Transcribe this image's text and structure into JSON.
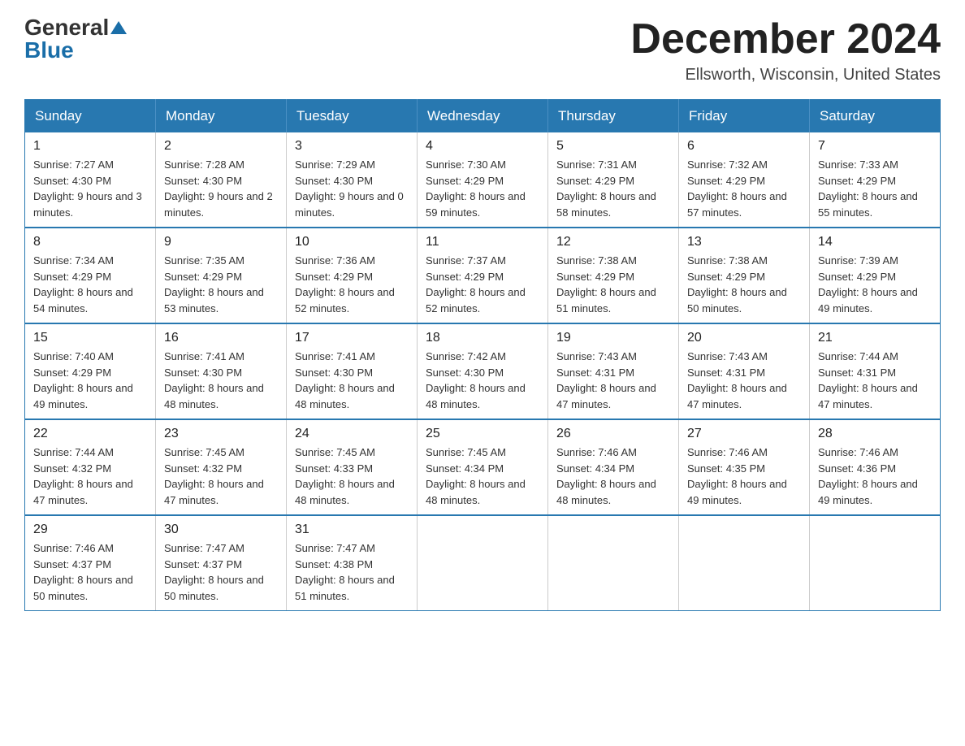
{
  "logo": {
    "general": "General",
    "blue": "Blue"
  },
  "title": {
    "month": "December 2024",
    "location": "Ellsworth, Wisconsin, United States"
  },
  "weekdays": [
    "Sunday",
    "Monday",
    "Tuesday",
    "Wednesday",
    "Thursday",
    "Friday",
    "Saturday"
  ],
  "weeks": [
    [
      {
        "day": "1",
        "sunrise": "7:27 AM",
        "sunset": "4:30 PM",
        "daylight": "9 hours and 3 minutes."
      },
      {
        "day": "2",
        "sunrise": "7:28 AM",
        "sunset": "4:30 PM",
        "daylight": "9 hours and 2 minutes."
      },
      {
        "day": "3",
        "sunrise": "7:29 AM",
        "sunset": "4:30 PM",
        "daylight": "9 hours and 0 minutes."
      },
      {
        "day": "4",
        "sunrise": "7:30 AM",
        "sunset": "4:29 PM",
        "daylight": "8 hours and 59 minutes."
      },
      {
        "day": "5",
        "sunrise": "7:31 AM",
        "sunset": "4:29 PM",
        "daylight": "8 hours and 58 minutes."
      },
      {
        "day": "6",
        "sunrise": "7:32 AM",
        "sunset": "4:29 PM",
        "daylight": "8 hours and 57 minutes."
      },
      {
        "day": "7",
        "sunrise": "7:33 AM",
        "sunset": "4:29 PM",
        "daylight": "8 hours and 55 minutes."
      }
    ],
    [
      {
        "day": "8",
        "sunrise": "7:34 AM",
        "sunset": "4:29 PM",
        "daylight": "8 hours and 54 minutes."
      },
      {
        "day": "9",
        "sunrise": "7:35 AM",
        "sunset": "4:29 PM",
        "daylight": "8 hours and 53 minutes."
      },
      {
        "day": "10",
        "sunrise": "7:36 AM",
        "sunset": "4:29 PM",
        "daylight": "8 hours and 52 minutes."
      },
      {
        "day": "11",
        "sunrise": "7:37 AM",
        "sunset": "4:29 PM",
        "daylight": "8 hours and 52 minutes."
      },
      {
        "day": "12",
        "sunrise": "7:38 AM",
        "sunset": "4:29 PM",
        "daylight": "8 hours and 51 minutes."
      },
      {
        "day": "13",
        "sunrise": "7:38 AM",
        "sunset": "4:29 PM",
        "daylight": "8 hours and 50 minutes."
      },
      {
        "day": "14",
        "sunrise": "7:39 AM",
        "sunset": "4:29 PM",
        "daylight": "8 hours and 49 minutes."
      }
    ],
    [
      {
        "day": "15",
        "sunrise": "7:40 AM",
        "sunset": "4:29 PM",
        "daylight": "8 hours and 49 minutes."
      },
      {
        "day": "16",
        "sunrise": "7:41 AM",
        "sunset": "4:30 PM",
        "daylight": "8 hours and 48 minutes."
      },
      {
        "day": "17",
        "sunrise": "7:41 AM",
        "sunset": "4:30 PM",
        "daylight": "8 hours and 48 minutes."
      },
      {
        "day": "18",
        "sunrise": "7:42 AM",
        "sunset": "4:30 PM",
        "daylight": "8 hours and 48 minutes."
      },
      {
        "day": "19",
        "sunrise": "7:43 AM",
        "sunset": "4:31 PM",
        "daylight": "8 hours and 47 minutes."
      },
      {
        "day": "20",
        "sunrise": "7:43 AM",
        "sunset": "4:31 PM",
        "daylight": "8 hours and 47 minutes."
      },
      {
        "day": "21",
        "sunrise": "7:44 AM",
        "sunset": "4:31 PM",
        "daylight": "8 hours and 47 minutes."
      }
    ],
    [
      {
        "day": "22",
        "sunrise": "7:44 AM",
        "sunset": "4:32 PM",
        "daylight": "8 hours and 47 minutes."
      },
      {
        "day": "23",
        "sunrise": "7:45 AM",
        "sunset": "4:32 PM",
        "daylight": "8 hours and 47 minutes."
      },
      {
        "day": "24",
        "sunrise": "7:45 AM",
        "sunset": "4:33 PM",
        "daylight": "8 hours and 48 minutes."
      },
      {
        "day": "25",
        "sunrise": "7:45 AM",
        "sunset": "4:34 PM",
        "daylight": "8 hours and 48 minutes."
      },
      {
        "day": "26",
        "sunrise": "7:46 AM",
        "sunset": "4:34 PM",
        "daylight": "8 hours and 48 minutes."
      },
      {
        "day": "27",
        "sunrise": "7:46 AM",
        "sunset": "4:35 PM",
        "daylight": "8 hours and 49 minutes."
      },
      {
        "day": "28",
        "sunrise": "7:46 AM",
        "sunset": "4:36 PM",
        "daylight": "8 hours and 49 minutes."
      }
    ],
    [
      {
        "day": "29",
        "sunrise": "7:46 AM",
        "sunset": "4:37 PM",
        "daylight": "8 hours and 50 minutes."
      },
      {
        "day": "30",
        "sunrise": "7:47 AM",
        "sunset": "4:37 PM",
        "daylight": "8 hours and 50 minutes."
      },
      {
        "day": "31",
        "sunrise": "7:47 AM",
        "sunset": "4:38 PM",
        "daylight": "8 hours and 51 minutes."
      },
      null,
      null,
      null,
      null
    ]
  ],
  "labels": {
    "sunrise": "Sunrise:",
    "sunset": "Sunset:",
    "daylight": "Daylight:"
  }
}
